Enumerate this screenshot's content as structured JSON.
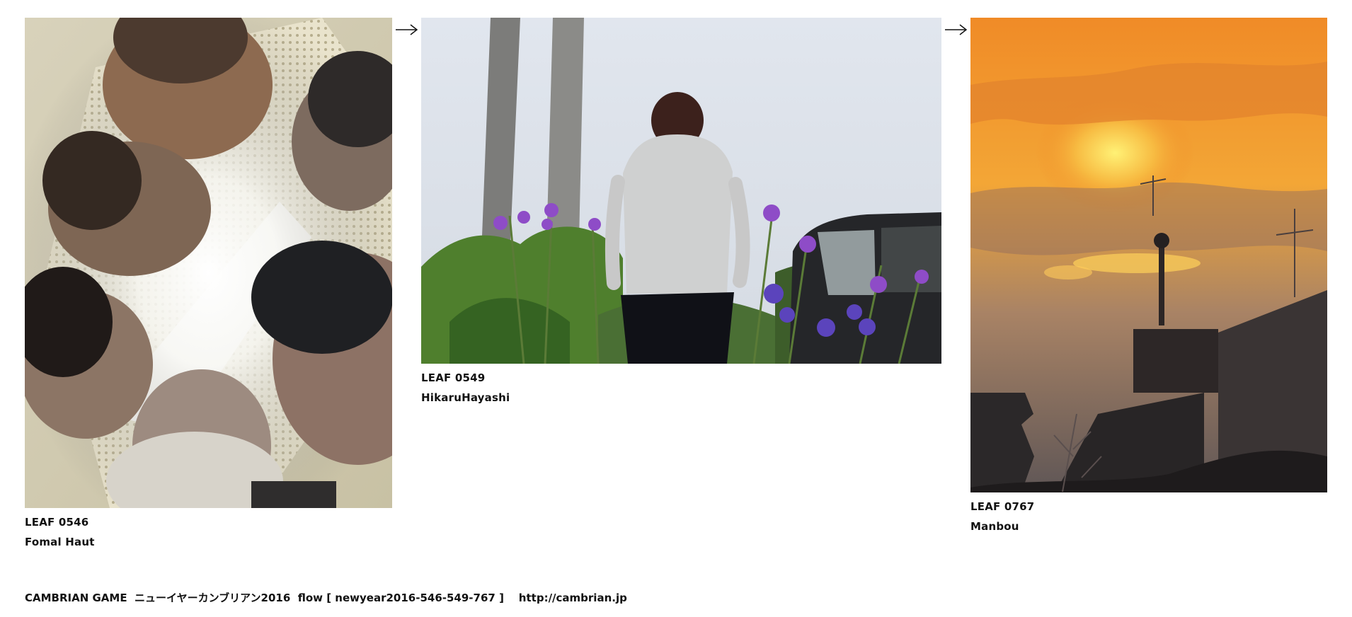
{
  "cards": [
    {
      "leaf_label": "LEAF 0546",
      "author": "Fomal Haut",
      "image_subject": "looking up at faces around ceiling light"
    },
    {
      "leaf_label": "LEAF 0549",
      "author": "HikaruHayashi",
      "image_subject": "person facing away among purple flowers"
    },
    {
      "leaf_label": "LEAF 0767",
      "author": "Manbou",
      "image_subject": "orange sunset sky over rooftops"
    }
  ],
  "arrows": [
    "right-arrow",
    "right-arrow"
  ],
  "footer": {
    "text": "CAMBRIAN GAME  ニューイヤーカンブリアン2016  flow [ newyear2016-546-549-767 ]    http://cambrian.jp"
  },
  "colors": {
    "background": "#ffffff",
    "text": "#111111",
    "sunset_orange": "#f29a2e",
    "flower_purple": "#8e4cc7"
  }
}
